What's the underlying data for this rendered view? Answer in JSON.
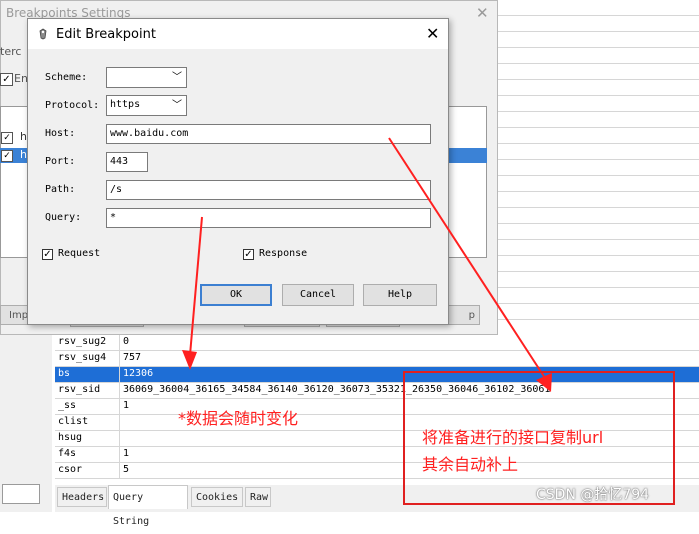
{
  "background_window": {
    "title": "Breakpoints Settings",
    "close_glyph": "✕",
    "fragment_label_1": "terc",
    "fragment_label_2": "Ena",
    "row1_text": "h",
    "row2_text": "h",
    "btn_import_fragment": "Imp",
    "btn_last_fragment": "p"
  },
  "dialog": {
    "title": "Edit Breakpoint",
    "close_glyph": "✕",
    "fields": {
      "scheme": {
        "label": "Scheme:",
        "value": ""
      },
      "protocol": {
        "label": "Protocol:",
        "value": "https"
      },
      "host": {
        "label": "Host:",
        "value": "www.baidu.com"
      },
      "port": {
        "label": "Port:",
        "value": "443"
      },
      "path": {
        "label": "Path:",
        "value": "/s"
      },
      "query": {
        "label": "Query:",
        "value": "*"
      }
    },
    "request": {
      "label": "Request",
      "checked": true
    },
    "response": {
      "label": "Response",
      "checked": true
    },
    "buttons": {
      "ok": "OK",
      "cancel": "Cancel",
      "help": "Help"
    }
  },
  "query_table": {
    "rows": [
      {
        "key": "rsv_sug2",
        "value": "0",
        "selected": false
      },
      {
        "key": "rsv_sug4",
        "value": "757",
        "selected": false
      },
      {
        "key": "bs",
        "value": "12306",
        "selected": true
      },
      {
        "key": "rsv_sid",
        "value": "36069_36004_36165_34584_36140_36120_36073_35321_26350_36046_36102_36061",
        "selected": false
      },
      {
        "key": "_ss",
        "value": "1",
        "selected": false
      },
      {
        "key": "clist",
        "value": "",
        "selected": false
      },
      {
        "key": "hsug",
        "value": "",
        "selected": false
      },
      {
        "key": "f4s",
        "value": "1",
        "selected": false
      },
      {
        "key": "csor",
        "value": "5",
        "selected": false
      }
    ]
  },
  "tabs": [
    {
      "label": "Headers",
      "active": false
    },
    {
      "label": "Query String",
      "active": true
    },
    {
      "label": "Cookies",
      "active": false
    },
    {
      "label": "Raw",
      "active": false
    }
  ],
  "annotations": {
    "note1": "*数据会随时变化",
    "note2_line1": "将准备进行的接口复制url",
    "note2_line2": "其余自动补上",
    "color": "#ff2020"
  },
  "watermark": "CSDN @拾忆794",
  "colors": {
    "selection": "#1e6ed6",
    "default_button_border": "#3c7fd1"
  }
}
